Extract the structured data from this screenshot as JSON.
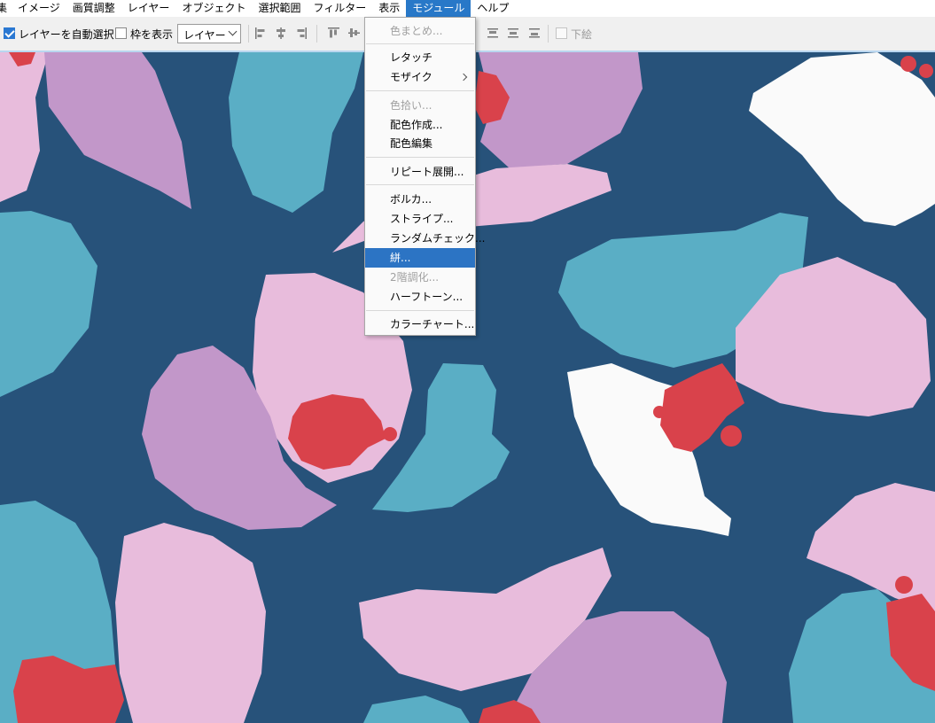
{
  "menubar": {
    "items": [
      "集",
      "イメージ",
      "画質調整",
      "レイヤー",
      "オブジェクト",
      "選択範囲",
      "フィルター",
      "表示",
      "モジュール",
      "ヘルプ"
    ],
    "active": "モジュール"
  },
  "toolbar": {
    "auto_select_label": "レイヤーを自動選択",
    "auto_select_checked": true,
    "show_frame_label": "枠を表示",
    "show_frame_checked": false,
    "layer_select_value": "レイヤー",
    "bottom_label": "下絵",
    "bottom_checked": false
  },
  "module_menu": {
    "items": [
      {
        "label": "色まとめ...",
        "enabled": false
      },
      {
        "label": "レタッチ",
        "enabled": true
      },
      {
        "label": "モザイク",
        "enabled": true,
        "submenu": true
      },
      {
        "label": "色拾い...",
        "enabled": false
      },
      {
        "label": "配色作成...",
        "enabled": true
      },
      {
        "label": "配色編集",
        "enabled": true
      },
      {
        "label": "リピート展開...",
        "enabled": true
      },
      {
        "label": "ボルカ...",
        "enabled": true
      },
      {
        "label": "ストライプ...",
        "enabled": true
      },
      {
        "label": "ランダムチェック...",
        "enabled": true
      },
      {
        "label": "絣...",
        "enabled": true,
        "highlighted": true
      },
      {
        "label": "2階調化...",
        "enabled": false
      },
      {
        "label": "ハーフトーン...",
        "enabled": true
      },
      {
        "label": "カラーチャート...",
        "enabled": true
      }
    ]
  },
  "colors": {
    "background": "#27527a",
    "teal": "#5aaec5",
    "pink": "#e8bcdc",
    "lavender": "#c297c9",
    "white": "#fafafa",
    "red": "#d9424b",
    "menu_highlight": "#2c74c4"
  }
}
